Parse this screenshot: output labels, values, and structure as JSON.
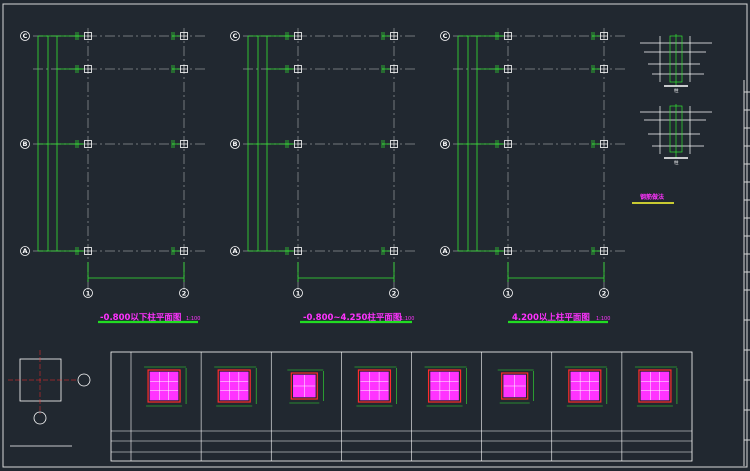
{
  "colors": {
    "background": "#212830",
    "frame": "#d8d8d8",
    "axis": "#c8c8c8",
    "green": "#33e633",
    "magenta": "#ff33ff",
    "red": "#ff2b2b",
    "yellow": "#ffff33",
    "title_underline": "#22dd22"
  },
  "plans": [
    {
      "title": "-0.800以下柱平面图",
      "scale": "1:100"
    },
    {
      "title": "-0.800~4.250柱平面图",
      "scale": "1:100"
    },
    {
      "title": "4.200以上柱平面图",
      "scale": "1:100"
    }
  ],
  "grid_labels": {
    "rows": [
      "C",
      "B",
      "A"
    ],
    "columns": [
      "1",
      "2"
    ]
  },
  "legend": {
    "note": "钢筋做法",
    "section_labels": [
      "柱",
      "柱"
    ]
  },
  "schedule": {
    "columns": 8
  }
}
